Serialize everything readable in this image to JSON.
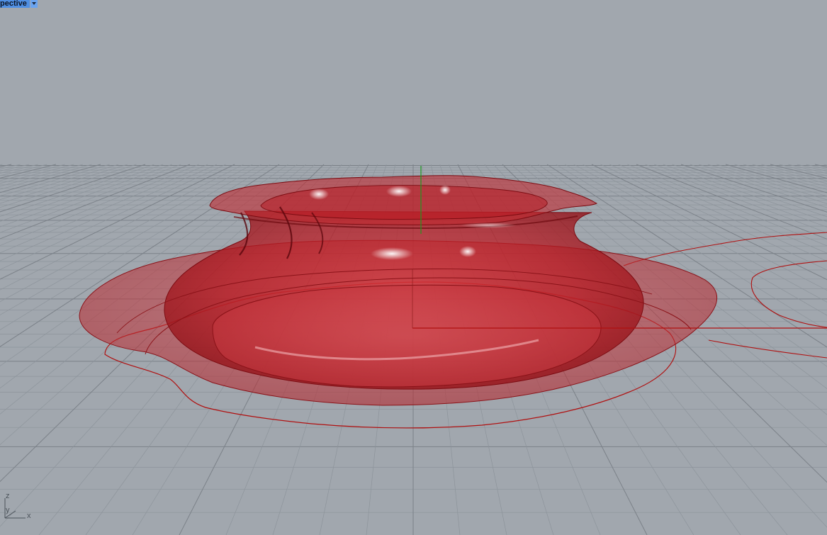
{
  "viewport": {
    "title": "pective",
    "menu_icon": "chevron-down-icon"
  },
  "axes": {
    "z_label": "z",
    "y_label": "y",
    "x_label": "x"
  },
  "colors": {
    "background": "#a1a7ae",
    "grid_line": "#8d949b",
    "grid_major": "#7b8188",
    "object_red": "#c8262c",
    "curve_red": "#b01010",
    "axis_x": "#b01010",
    "axis_y": "#1e9a1e",
    "title_bg": "#4f8fe3"
  }
}
